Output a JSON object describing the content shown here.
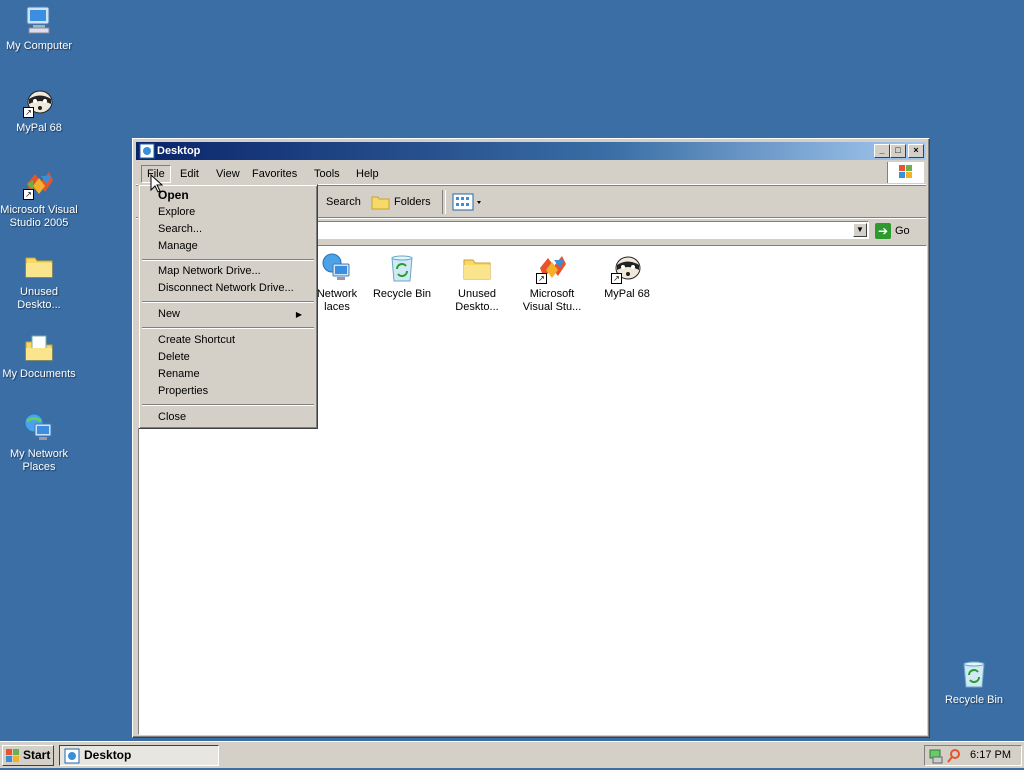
{
  "desktop": {
    "icons": [
      {
        "label": "My Computer",
        "icon": "my-computer-icon"
      },
      {
        "label": "MyPal 68",
        "icon": "mypal-icon"
      },
      {
        "label": "Microsoft Visual Studio 2005",
        "icon": "visual-studio-icon"
      },
      {
        "label": "Unused Deskto...",
        "icon": "folder-icon"
      },
      {
        "label": "My Documents",
        "icon": "my-documents-icon"
      },
      {
        "label": "My Network Places",
        "icon": "network-places-icon"
      },
      {
        "label": "Recycle Bin",
        "icon": "recycle-bin-icon"
      }
    ]
  },
  "window": {
    "title": "Desktop",
    "menu": [
      "File",
      "Edit",
      "View",
      "Favorites",
      "Tools",
      "Help"
    ],
    "toolbar": {
      "search": "Search",
      "folders": "Folders"
    },
    "go_label": "Go",
    "files": [
      {
        "label": "Network Places",
        "line1": "Network",
        "line2": "laces",
        "icon": "network-places-icon"
      },
      {
        "label": "Recycle Bin",
        "line1": "Recycle Bin",
        "line2": "",
        "icon": "recycle-bin-icon"
      },
      {
        "label": "Unused Deskto...",
        "line1": "Unused",
        "line2": "Deskto...",
        "icon": "folder-icon"
      },
      {
        "label": "Microsoft Visual Stu...",
        "line1": "Microsoft",
        "line2": "Visual Stu...",
        "icon": "visual-studio-icon"
      },
      {
        "label": "MyPal 68",
        "line1": "MyPal 68",
        "line2": "",
        "icon": "mypal-icon"
      }
    ]
  },
  "file_menu": {
    "items": [
      "Open",
      "Explore",
      "Search...",
      "Manage",
      "Map Network Drive...",
      "Disconnect Network Drive...",
      "New",
      "Create Shortcut",
      "Delete",
      "Rename",
      "Properties",
      "Close"
    ]
  },
  "taskbar": {
    "start": "Start",
    "task": "Desktop",
    "clock": "6:17 PM"
  },
  "colors": {
    "desktop": "#3a6ea5",
    "titlebar": "#0a246a",
    "chrome": "#d4d0c8"
  }
}
